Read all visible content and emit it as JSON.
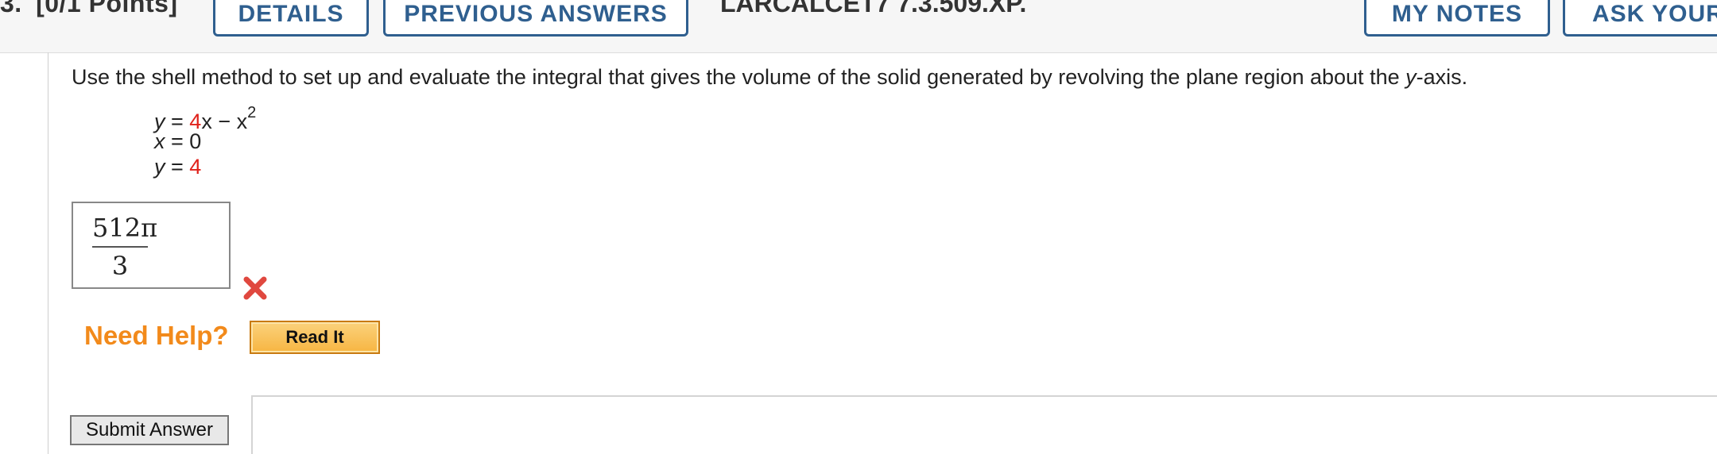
{
  "header": {
    "question_number": "3.",
    "points": "[0/1 Points]",
    "details_label": "DETAILS",
    "previous_answers_label": "PREVIOUS ANSWERS",
    "problem_id": "LARCALCET7 7.3.509.XP.",
    "my_notes_label": "MY NOTES",
    "ask_label": "ASK YOUR"
  },
  "question": {
    "prompt_part1": "Use the shell method to set up and evaluate the integral that gives the volume of the solid generated by revolving the plane region about the ",
    "prompt_var": "y",
    "prompt_part2": "-axis.",
    "equations": [
      {
        "lhs": "y",
        "eq": " = ",
        "red": "4",
        "rest": "x − x",
        "sup": "2"
      },
      {
        "lhs": "x",
        "eq": " = ",
        "value": "0"
      },
      {
        "lhs": "y",
        "eq": " = ",
        "red": "4"
      }
    ]
  },
  "answer": {
    "numerator": "512π",
    "denominator": "3",
    "status": "incorrect"
  },
  "help": {
    "label": "Need Help?",
    "read_it_label": "Read It"
  },
  "actions": {
    "submit_label": "Submit Answer"
  },
  "colors": {
    "accent_blue": "#2f5f8f",
    "red_value": "#e0221b",
    "help_orange": "#f28a1b",
    "error_red": "#e0483f"
  }
}
